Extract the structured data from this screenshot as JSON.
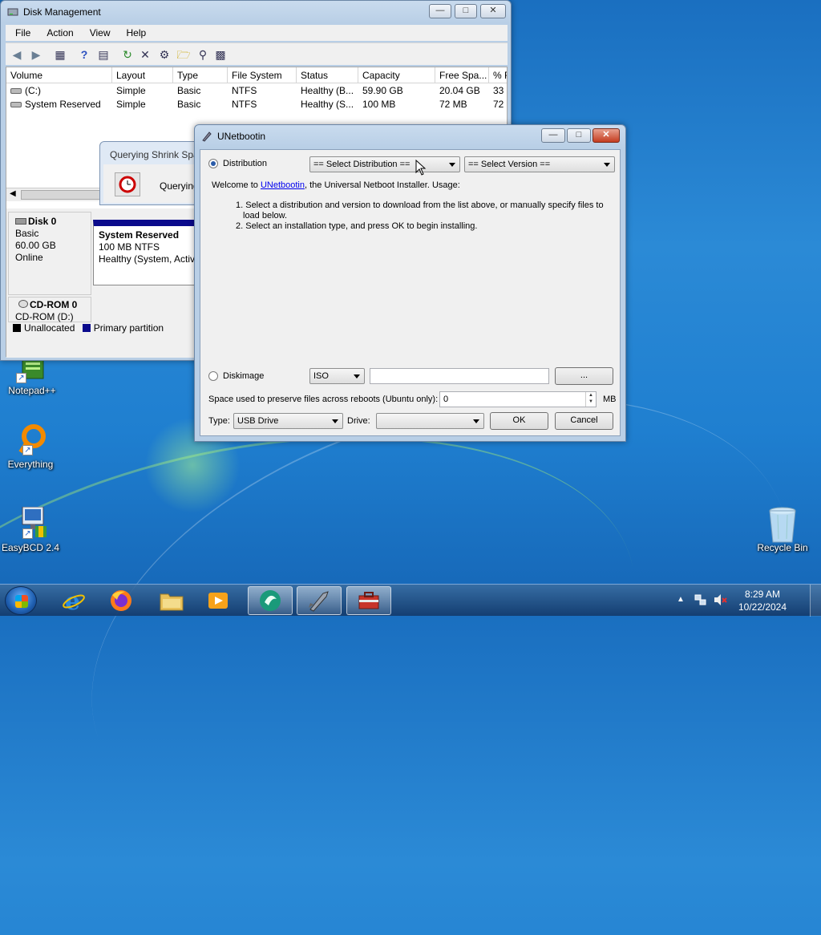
{
  "disk_management": {
    "title": "Disk Management",
    "menu": [
      "File",
      "Action",
      "View",
      "Help"
    ],
    "columns": [
      "Volume",
      "Layout",
      "Type",
      "File System",
      "Status",
      "Capacity",
      "Free Spa...",
      "% F"
    ],
    "rows": [
      [
        "(C:)",
        "Simple",
        "Basic",
        "NTFS",
        "Healthy (B...",
        "59.90 GB",
        "20.04 GB",
        "33"
      ],
      [
        "System Reserved",
        "Simple",
        "Basic",
        "NTFS",
        "Healthy (S...",
        "100 MB",
        "72 MB",
        "72"
      ]
    ],
    "disk0": {
      "name": "Disk 0",
      "type": "Basic",
      "size": "60.00 GB",
      "state": "Online"
    },
    "partition": {
      "name": "System Reserved",
      "size": "100 MB NTFS",
      "status": "Healthy (System, Activ"
    },
    "cdrom": {
      "name": "CD-ROM 0",
      "drive": "CD-ROM (D:)"
    },
    "legend": {
      "unallocated": "Unallocated",
      "primary": "Primary partition"
    },
    "colors": {
      "primary": "#0a0a8c",
      "unallocated": "#000000"
    }
  },
  "shrink_dialog": {
    "title": "Querying Shrink Spa",
    "text": "Querying"
  },
  "unetbootin": {
    "title": "UNetbootin",
    "distribution_label": "Distribution",
    "distribution_select": "== Select Distribution ==",
    "version_select": "== Select Version ==",
    "welcome_prefix": "Welcome to ",
    "welcome_link": "UNetbootin",
    "welcome_suffix": ", the Universal Netboot Installer. Usage:",
    "step1": "1. Select a distribution and version to download from the list above, or manually specify files to",
    "step1b": "load below.",
    "step2": "2. Select an installation type, and press OK to begin installing.",
    "diskimage_label": "Diskimage",
    "diskimage_type": "ISO",
    "browse_label": "...",
    "persist_label": "Space used to preserve files across reboots (Ubuntu only):",
    "persist_value": "0",
    "persist_unit": "MB",
    "type_label": "Type:",
    "type_value": "USB Drive",
    "drive_label": "Drive:",
    "drive_value": "",
    "ok_label": "OK",
    "cancel_label": "Cancel"
  },
  "desktop_icons": [
    {
      "label": "Notepad++",
      "icon": "notepad-plus-plus-icon"
    },
    {
      "label": "Everything",
      "icon": "everything-search-icon"
    },
    {
      "label": "EasyBCD 2.4",
      "icon": "easybcd-icon"
    },
    {
      "label": "Recycle Bin",
      "icon": "recycle-bin-icon"
    }
  ],
  "taskbar": {
    "apps": [
      "internet-explorer-icon",
      "firefox-icon",
      "file-explorer-icon",
      "media-player-icon",
      "app-green-icon",
      "unetbootin-icon",
      "disk-toolbox-icon"
    ],
    "time": "8:29 AM",
    "date": "10/22/2024"
  }
}
